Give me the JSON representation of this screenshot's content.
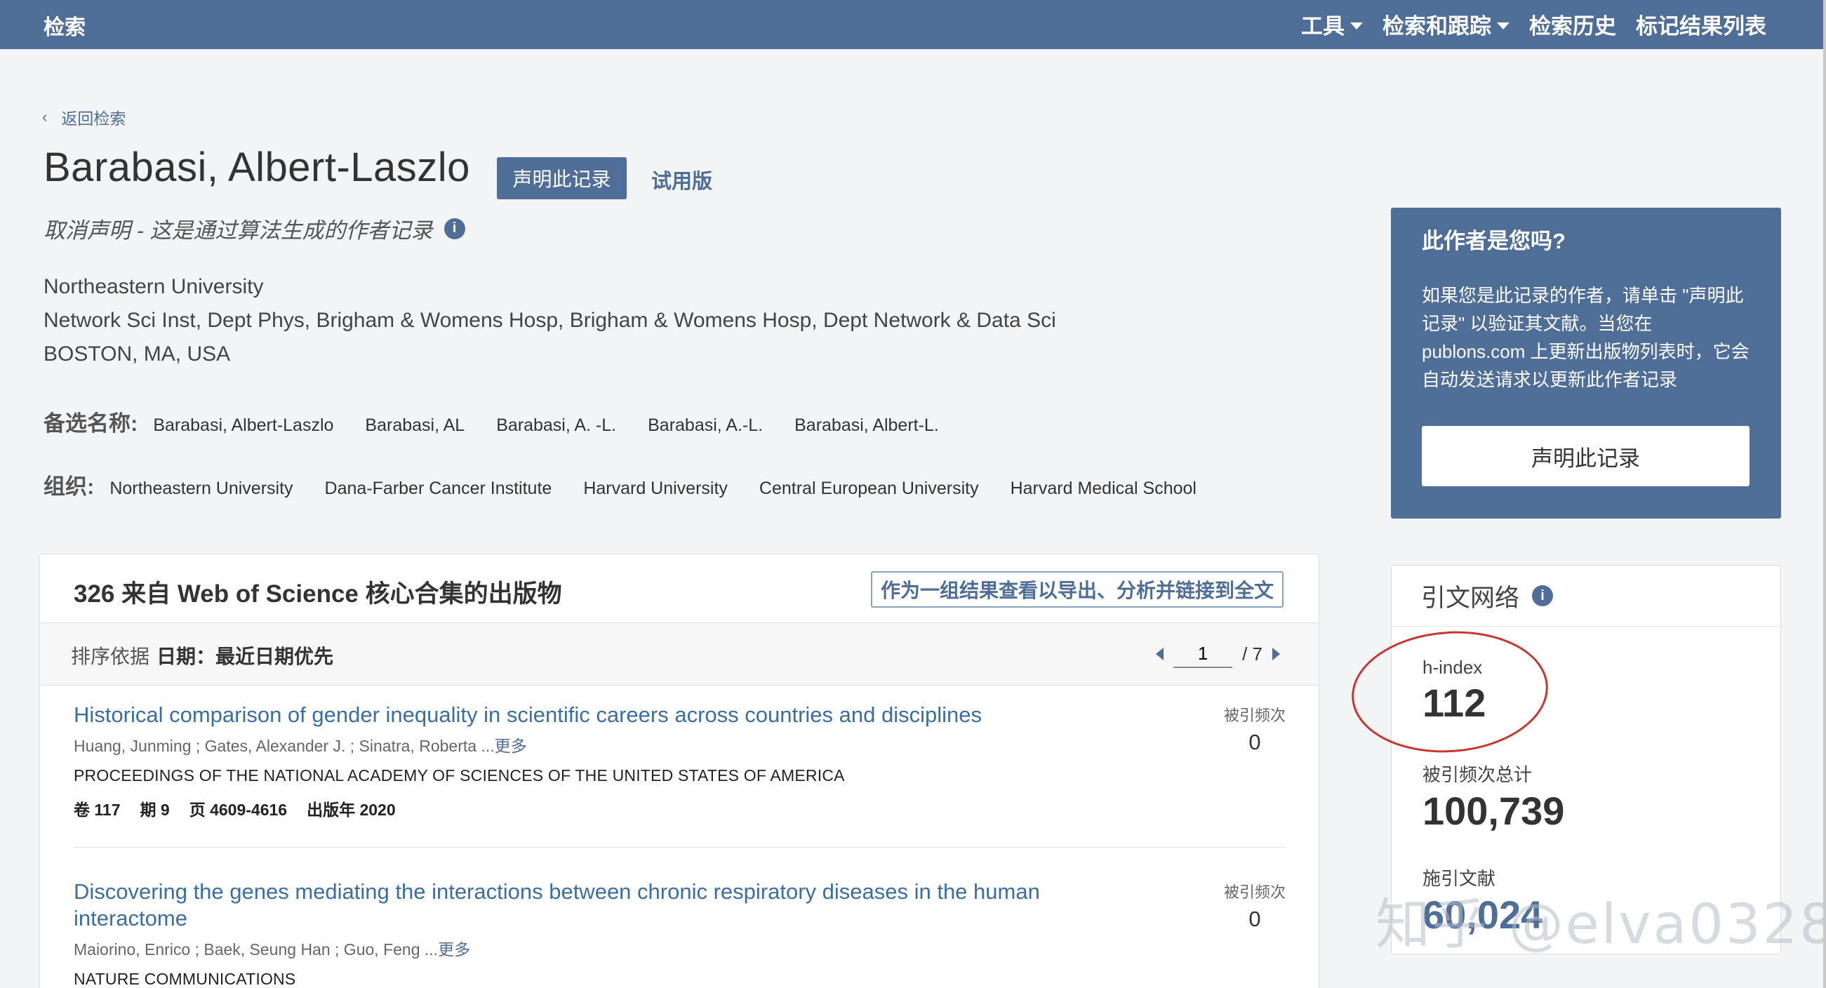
{
  "topbar": {
    "brand": "检索",
    "nav": [
      {
        "label": "工具",
        "has_dropdown": true
      },
      {
        "label": "检索和跟踪",
        "has_dropdown": true
      },
      {
        "label": "检索历史",
        "has_dropdown": false
      },
      {
        "label": "标记结果列表",
        "has_dropdown": false
      }
    ]
  },
  "back_link": "返回检索",
  "author": {
    "name": "Barabasi, Albert-Laszlo",
    "claim_button": "声明此记录",
    "trial_label": "试用版",
    "unclaim_text": "取消声明 - 这是通过算法生成的作者记录",
    "affiliation_lines": [
      "Northeastern University",
      "Network Sci Inst, Dept Phys, Brigham & Womens Hosp, Brigham & Womens Hosp, Dept Network & Data Sci",
      "BOSTON, MA, USA"
    ],
    "alt_names_label": "备选名称:",
    "alt_names": [
      "Barabasi, Albert-Laszlo",
      "Barabasi, AL",
      "Barabasi, A. -L.",
      "Barabasi, A.-L.",
      "Barabasi, Albert-L."
    ],
    "orgs_label": "组织:",
    "orgs": [
      "Northeastern University",
      "Dana-Farber Cancer Institute",
      "Harvard University",
      "Central European University",
      "Harvard Medical School"
    ]
  },
  "claim_panel": {
    "title": "此作者是您吗?",
    "description": "如果您是此记录的作者，请单击 \"声明此记录\" 以验证其文献。当您在 publons.com 上更新出版物列表时，它会自动发送请求以更新此作者记录",
    "button": "声明此记录"
  },
  "citation_network": {
    "title": "引文网络",
    "metrics": [
      {
        "label": "h-index",
        "value": "112"
      },
      {
        "label": "被引频次总计",
        "value": "100,739"
      },
      {
        "label": "施引文献",
        "value": "60,024"
      }
    ]
  },
  "publications": {
    "header": "326 来自 Web of Science 核心合集的出版物",
    "export_button": "作为一组结果查看以导出、分析并链接到全文",
    "sort_label": "排序依据",
    "sort_value": "日期：最近日期优先",
    "page_current": "1",
    "page_total": "/ 7",
    "records": [
      {
        "title": "Historical comparison of gender inequality in scientific careers across countries and disciplines",
        "authors": "Huang, Junming ; Gates, Alexander J. ; Sinatra, Roberta ...",
        "more": "更多",
        "journal": "PROCEEDINGS OF THE NATIONAL ACADEMY OF SCIENCES OF THE UNITED STATES OF AMERICA",
        "volume": "卷 117",
        "issue": "期 9",
        "pages": "页 4609-4616",
        "year": "出版年 2020",
        "cites_label": "被引频次",
        "cites": "0"
      },
      {
        "title": "Discovering the genes mediating the interactions between chronic respiratory diseases in the human interactome",
        "authors": "Maiorino, Enrico ; Baek, Seung Han ; Guo, Feng ...",
        "more": "更多",
        "journal": "NATURE COMMUNICATIONS",
        "cites_label": "被引频次",
        "cites": "0"
      }
    ]
  },
  "watermark": "知乎 @elva0328",
  "colors": {
    "brand": "#4f6e97",
    "link": "#3a6fa3",
    "annotation": "#c9352f"
  }
}
